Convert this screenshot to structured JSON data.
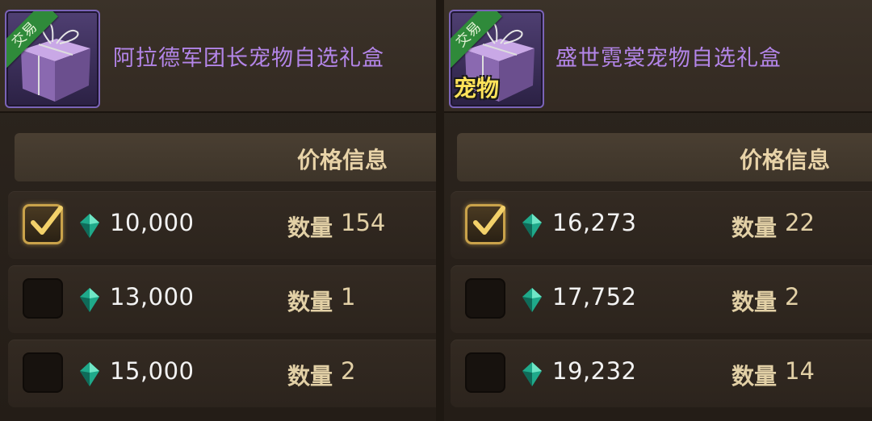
{
  "colors": {
    "item_name": "#b385e8",
    "header_text": "#e8d3a8",
    "price_text": "#f2f2f2",
    "quantity_text": "#e2d0a6",
    "checkbox_checked_border": "#c9a24a",
    "trade_ribbon": "#2f8a3a",
    "pet_badge": "#ffe35a"
  },
  "listings": [
    {
      "item_name": "阿拉德军团长宠物自选礼盒",
      "trade_tag": "交易",
      "badge": "",
      "column_header": "价格信息",
      "rows": [
        {
          "selected": true,
          "price": "10,000",
          "qty_label": "数量",
          "qty": "154"
        },
        {
          "selected": false,
          "price": "13,000",
          "qty_label": "数量",
          "qty": "1"
        },
        {
          "selected": false,
          "price": "15,000",
          "qty_label": "数量",
          "qty": "2"
        }
      ]
    },
    {
      "item_name": "盛世霓裳宠物自选礼盒",
      "trade_tag": "交易",
      "badge": "宠物",
      "column_header": "价格信息",
      "rows": [
        {
          "selected": true,
          "price": "16,273",
          "qty_label": "数量",
          "qty": "22"
        },
        {
          "selected": false,
          "price": "17,752",
          "qty_label": "数量",
          "qty": "2"
        },
        {
          "selected": false,
          "price": "19,232",
          "qty_label": "数量",
          "qty": "14"
        }
      ]
    }
  ],
  "icons": {
    "gift_box": "gift-box-icon",
    "gem": "gem-currency-icon",
    "check": "checkmark-icon"
  }
}
